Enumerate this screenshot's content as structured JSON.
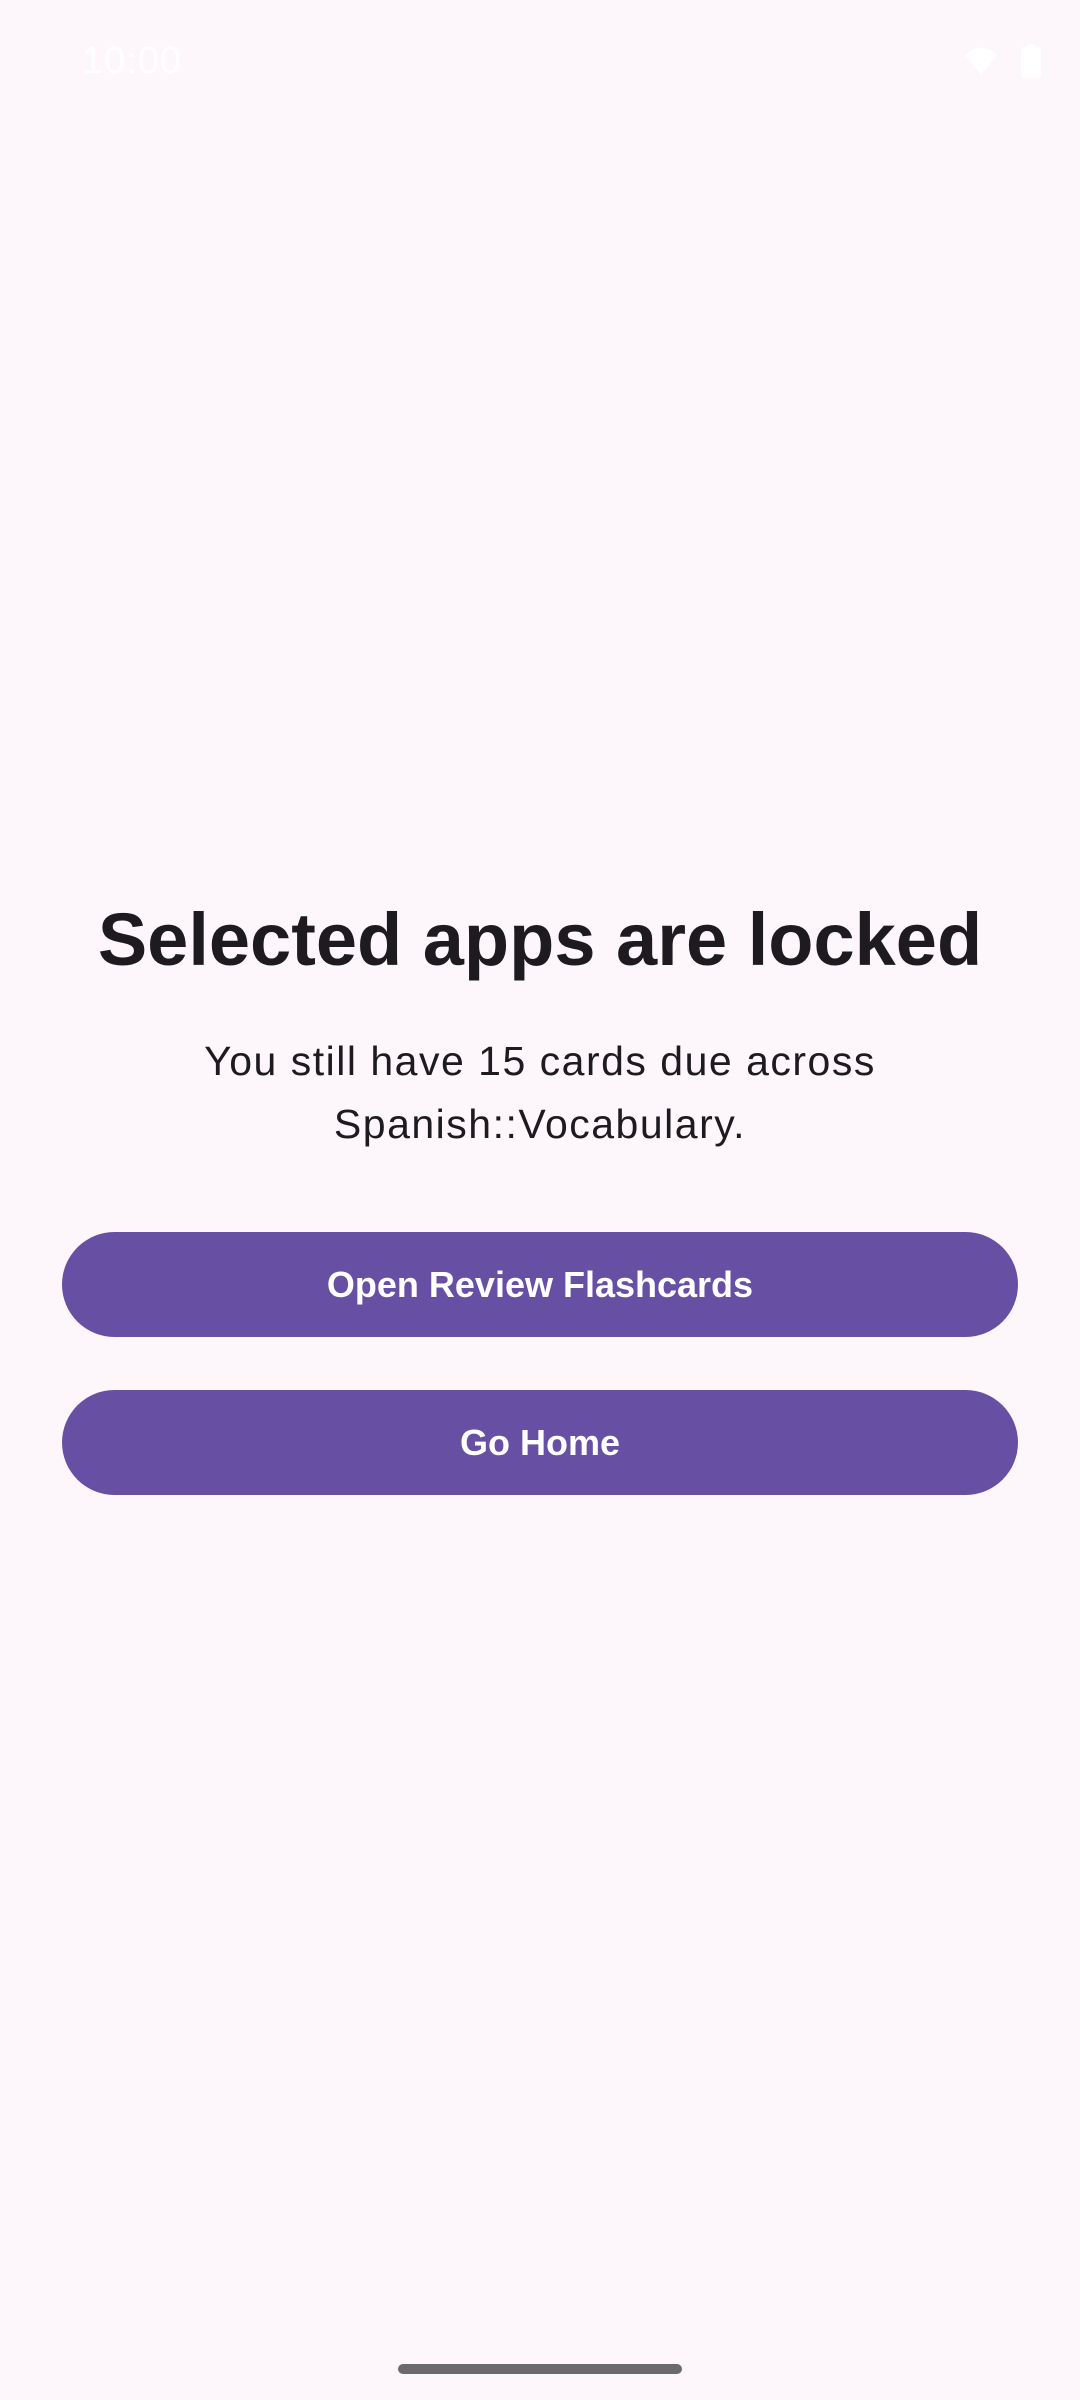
{
  "status_bar": {
    "time": "10:00",
    "icons": [
      "wifi-icon",
      "battery-icon"
    ]
  },
  "lock_screen": {
    "title": "Selected apps are locked",
    "message": "You still have 15 cards due across Spanish::Vocabulary.",
    "open_button_label": "Open Review Flashcards",
    "home_button_label": "Go Home"
  },
  "colors": {
    "background": "#fdf7fc",
    "primary": "#6750a4",
    "on_primary": "#ffffff",
    "text": "#1d1b20"
  }
}
